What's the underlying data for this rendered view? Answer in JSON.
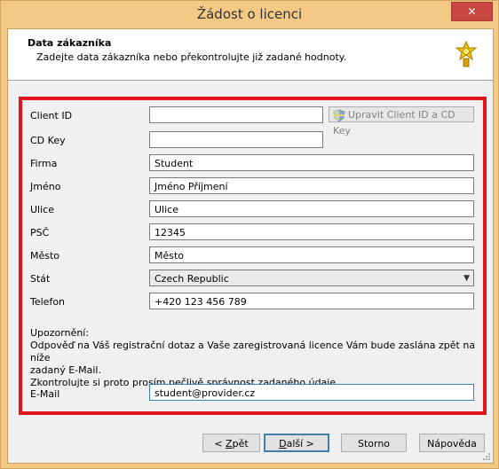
{
  "window": {
    "title": "Žádost o licenci",
    "close_label": "✕"
  },
  "header": {
    "title": "Data zákazníka",
    "subtitle": "Zadejte data zákazníka nebo překontrolujte již zadané hodnoty.",
    "icon": "award-medal-icon"
  },
  "form": {
    "client_id": {
      "label": "Client ID",
      "value": ""
    },
    "edit_button": {
      "label": "Upravit Client ID a CD Key",
      "icon": "uac-shield-icon"
    },
    "cd_key": {
      "label": "CD Key",
      "value": ""
    },
    "firma": {
      "label": "Firma",
      "value": "Student"
    },
    "jmeno": {
      "label": "Jméno",
      "value": "Jméno Příjmení"
    },
    "ulice": {
      "label": "Ulice",
      "value": "Ulice"
    },
    "psc": {
      "label": "PSČ",
      "value": "12345"
    },
    "mesto": {
      "label": "Město",
      "value": "Město"
    },
    "stat": {
      "label": "Stát",
      "value": "Czech Republic"
    },
    "telefon": {
      "label": "Telefon",
      "value": "+420 123 456 789"
    },
    "email": {
      "label": "E-Mail",
      "value": "student@provider.cz"
    }
  },
  "notice": {
    "heading": "Upozornění:",
    "line1": "Odpověď na Váš registrační dotaz a Vaše zaregistrovaná licence Vám bude zaslána zpět na níže",
    "line2": "zadaný E-Mail.",
    "line3": "Zkontrolujte si proto prosím pečlivě správnost zadaného údaje."
  },
  "buttons": {
    "back_pre": "< ",
    "back_key": "Z",
    "back_post": "pět",
    "next_key": "D",
    "next_post": "alší >",
    "cancel": "Storno",
    "help": "Nápověda"
  },
  "colors": {
    "highlight_frame": "#e0151b",
    "window_frame": "#f4c986",
    "default_button": "#3c7fb1"
  }
}
